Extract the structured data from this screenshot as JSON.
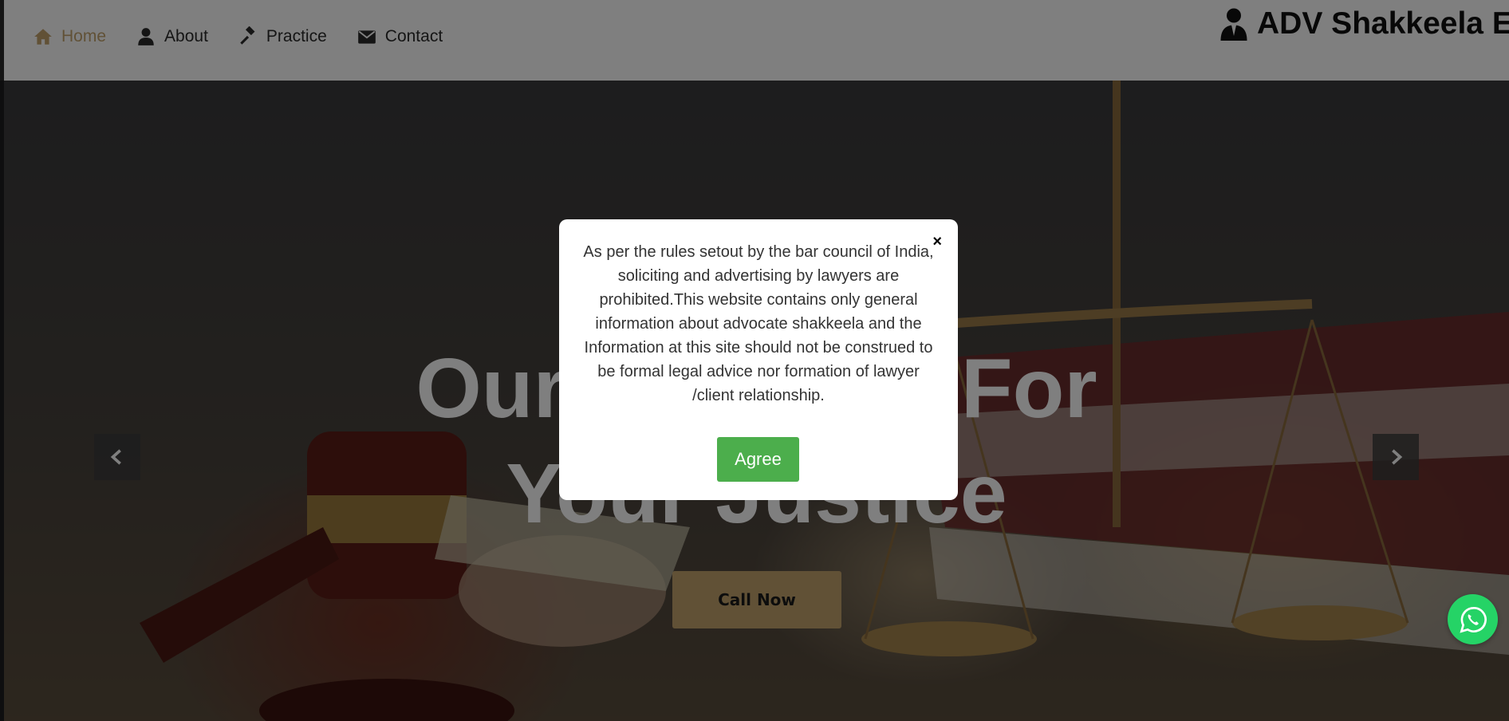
{
  "nav": {
    "items": [
      {
        "label": "Home",
        "icon": "home-icon",
        "active": true
      },
      {
        "label": "About",
        "icon": "user-icon",
        "active": false
      },
      {
        "label": "Practice",
        "icon": "gavel-icon",
        "active": false
      },
      {
        "label": "Contact",
        "icon": "envelope-icon",
        "active": false
      }
    ],
    "brand": "ADV Shakkeela E.I",
    "brand_icon": "lawyer-icon"
  },
  "hero": {
    "title_line1": "Our Services For",
    "title_line2": "Your Justice",
    "cta_label": "Call Now"
  },
  "modal": {
    "text": "As per the rules setout by the bar council of India, soliciting and advertising by lawyers are prohibited.This website contains only general information about advocate shakkeela and the Information at this site should not be construed to be formal legal advice nor formation of lawyer /client relationship.",
    "close_label": "×",
    "agree_label": "Agree"
  },
  "colors": {
    "accent": "#c2a26c",
    "agree_green": "#4cae4c",
    "whatsapp_green": "#25d366"
  }
}
